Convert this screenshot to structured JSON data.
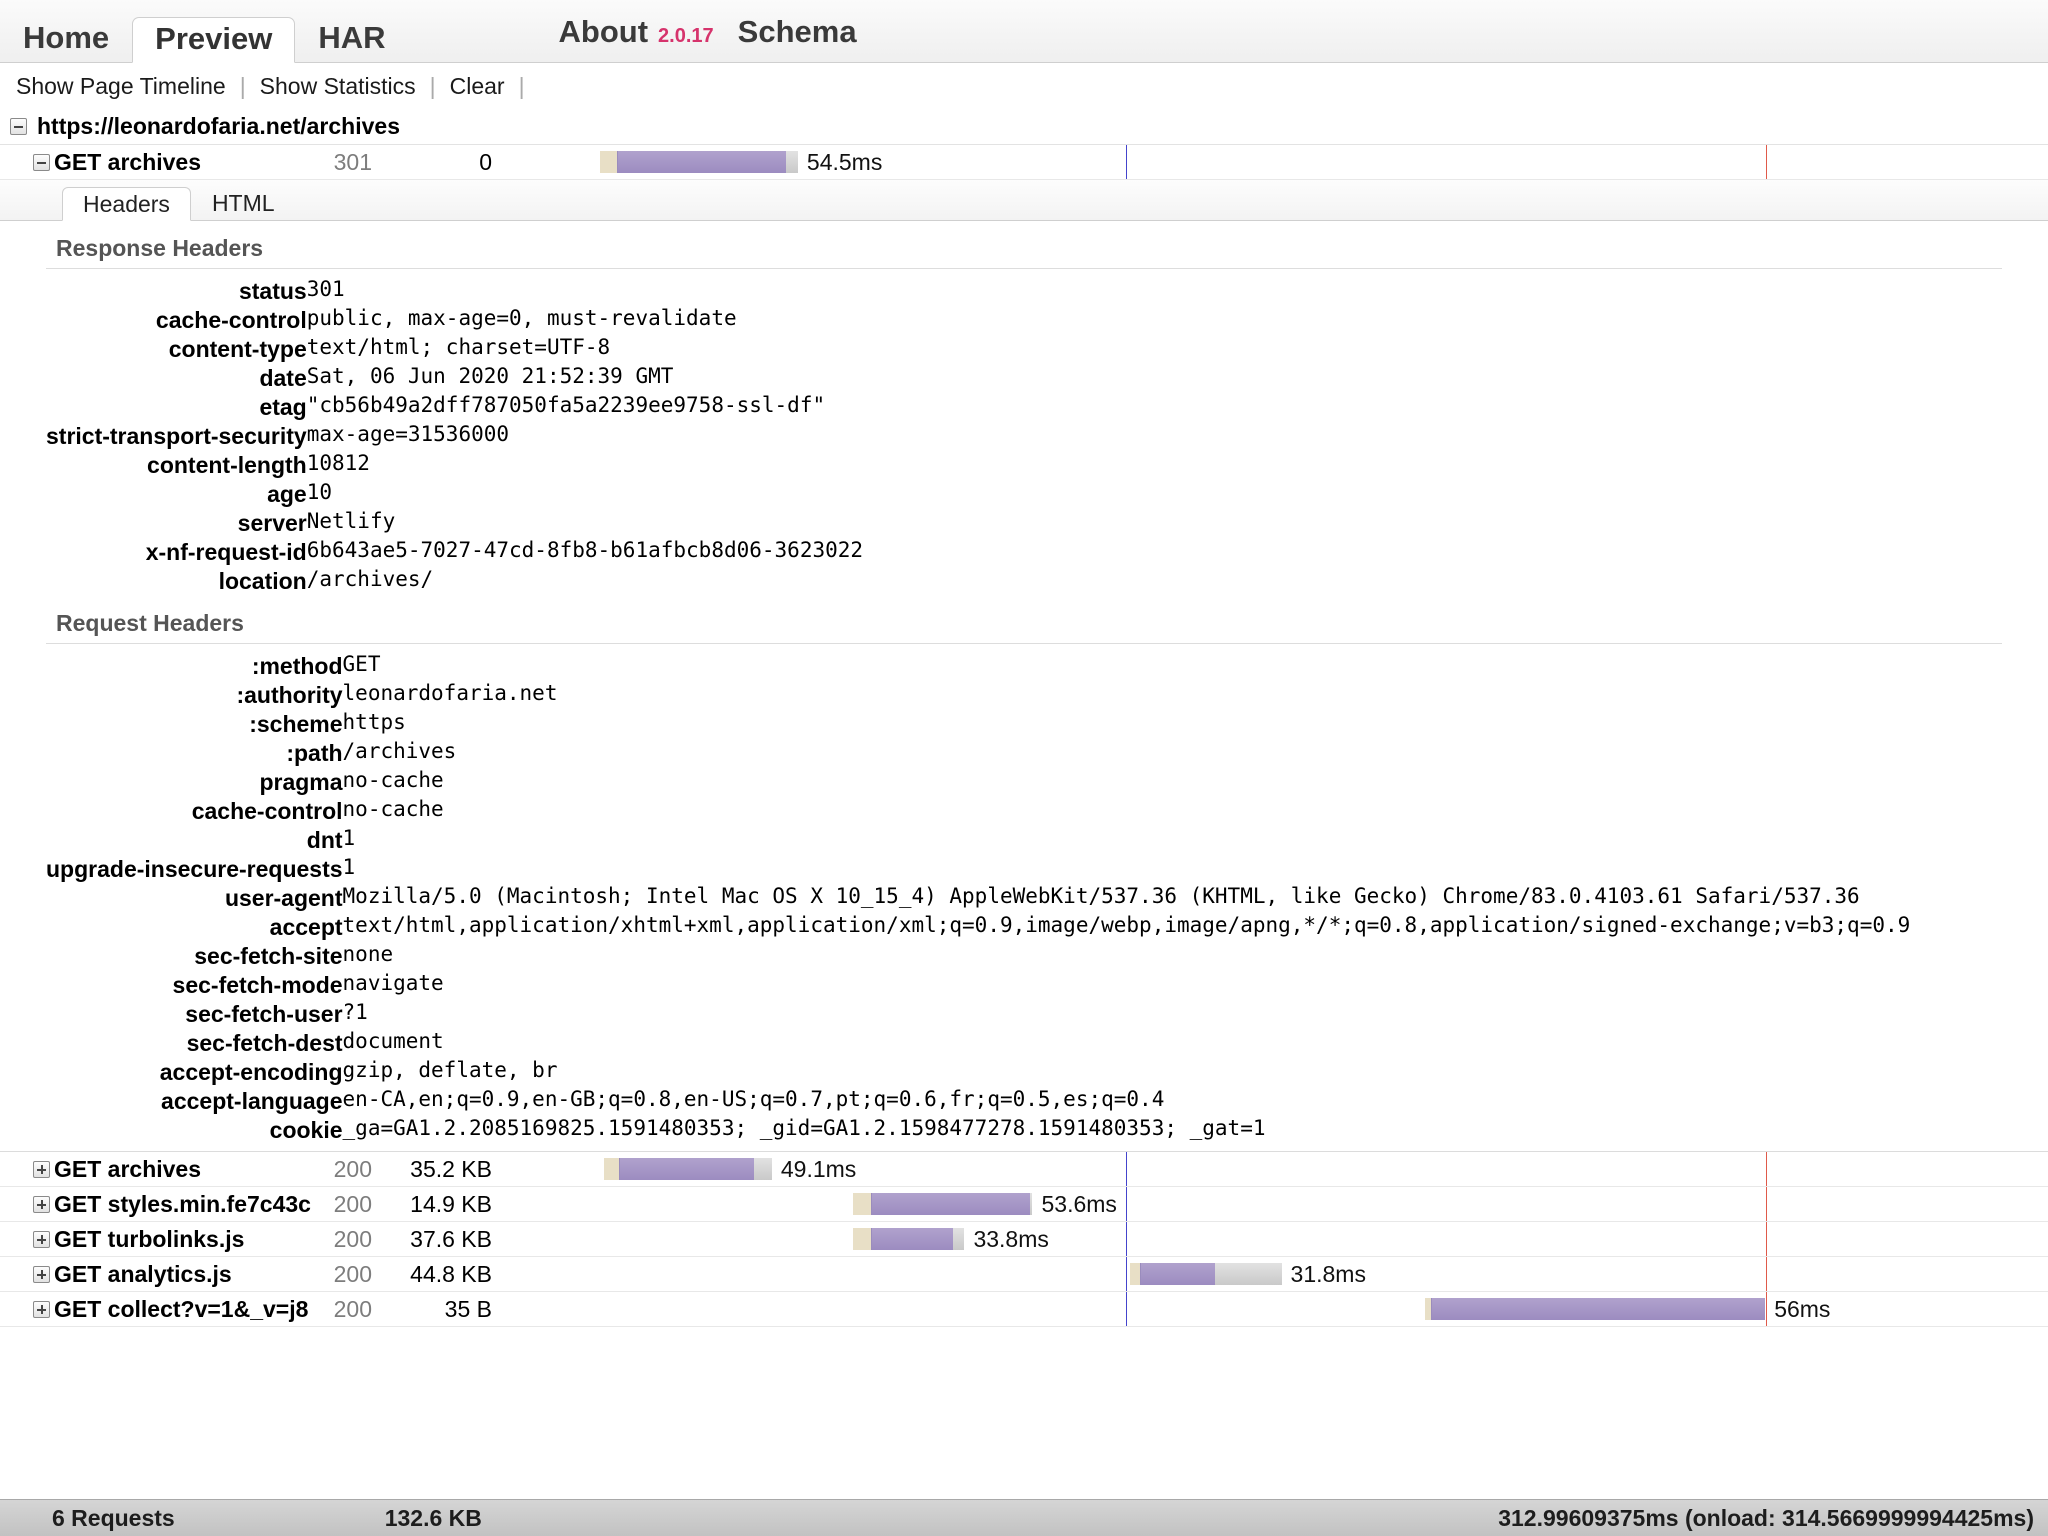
{
  "tabs": [
    {
      "label": "Home",
      "active": false
    },
    {
      "label": "Preview",
      "active": true
    },
    {
      "label": "HAR",
      "active": false
    }
  ],
  "about": {
    "label": "About",
    "version": "2.0.17",
    "schema": "Schema"
  },
  "toolbar": {
    "show_page_timeline": "Show Page Timeline",
    "show_statistics": "Show Statistics",
    "clear": "Clear",
    "separator": "|"
  },
  "page": {
    "url": "https://leonardofaria.net/archives"
  },
  "main_request": {
    "name": "GET archives",
    "status": "301",
    "size": "0",
    "time_label": "54.5ms",
    "bar": {
      "wait_pct": 1.2,
      "active_pct": 11.6,
      "tail_pct": 0.8,
      "offset_pct": 0
    }
  },
  "subtabs": [
    {
      "label": "Headers",
      "active": true
    },
    {
      "label": "HTML",
      "active": false
    }
  ],
  "response_headers": {
    "title": "Response Headers",
    "rows": [
      {
        "key": "status",
        "value": "301"
      },
      {
        "key": "cache-control",
        "value": "public, max-age=0, must-revalidate"
      },
      {
        "key": "content-type",
        "value": "text/html; charset=UTF-8"
      },
      {
        "key": "date",
        "value": "Sat, 06 Jun 2020 21:52:39 GMT"
      },
      {
        "key": "etag",
        "value": "\"cb56b49a2dff787050fa5a2239ee9758-ssl-df\""
      },
      {
        "key": "strict-transport-security",
        "value": "max-age=31536000"
      },
      {
        "key": "content-length",
        "value": "10812"
      },
      {
        "key": "age",
        "value": "10"
      },
      {
        "key": "server",
        "value": "Netlify"
      },
      {
        "key": "x-nf-request-id",
        "value": "6b643ae5-7027-47cd-8fb8-b61afbcb8d06-3623022"
      },
      {
        "key": "location",
        "value": "/archives/"
      }
    ]
  },
  "request_headers": {
    "title": "Request Headers",
    "rows": [
      {
        "key": ":method",
        "value": "GET"
      },
      {
        "key": ":authority",
        "value": "leonardofaria.net"
      },
      {
        "key": ":scheme",
        "value": "https"
      },
      {
        "key": ":path",
        "value": "/archives"
      },
      {
        "key": "pragma",
        "value": "no-cache"
      },
      {
        "key": "cache-control",
        "value": "no-cache"
      },
      {
        "key": "dnt",
        "value": "1"
      },
      {
        "key": "upgrade-insecure-requests",
        "value": "1"
      },
      {
        "key": "user-agent",
        "value": "Mozilla/5.0 (Macintosh; Intel Mac OS X 10_15_4) AppleWebKit/537.36 (KHTML, like Gecko) Chrome/83.0.4103.61 Safari/537.36"
      },
      {
        "key": "accept",
        "value": "text/html,application/xhtml+xml,application/xml;q=0.9,image/webp,image/apng,*/*;q=0.8,application/signed-exchange;v=b3;q=0.9"
      },
      {
        "key": "sec-fetch-site",
        "value": "none"
      },
      {
        "key": "sec-fetch-mode",
        "value": "navigate"
      },
      {
        "key": "sec-fetch-user",
        "value": "?1"
      },
      {
        "key": "sec-fetch-dest",
        "value": "document"
      },
      {
        "key": "accept-encoding",
        "value": "gzip, deflate, br"
      },
      {
        "key": "accept-language",
        "value": "en-CA,en;q=0.9,en-GB;q=0.8,en-US;q=0.7,pt;q=0.6,fr;q=0.5,es;q=0.4"
      },
      {
        "key": "cookie",
        "value": "_ga=GA1.2.2085169825.1591480353; _gid=GA1.2.1598477278.1591480353; _gat=1"
      }
    ]
  },
  "sub_requests": [
    {
      "name": "GET archives",
      "status": "200",
      "size": "35.2 KB",
      "time_label": "49.1ms",
      "bar": {
        "offset_pct": 0.3,
        "wait_pct": 1.0,
        "active_pct": 9.3,
        "tail_pct": 1.2
      }
    },
    {
      "name": "GET styles.min.fe7c43c",
      "status": "200",
      "size": "14.9 KB",
      "time_label": "53.6ms",
      "bar": {
        "offset_pct": 17.5,
        "wait_pct": 1.2,
        "active_pct": 10.9,
        "tail_pct": 0.2
      }
    },
    {
      "name": "GET turbolinks.js",
      "status": "200",
      "size": "37.6 KB",
      "time_label": "33.8ms",
      "bar": {
        "offset_pct": 17.5,
        "wait_pct": 1.2,
        "active_pct": 5.6,
        "tail_pct": 0.8
      }
    },
    {
      "name": "GET analytics.js",
      "status": "200",
      "size": "44.8 KB",
      "time_label": "31.8ms",
      "bar": {
        "offset_pct": 36.6,
        "wait_pct": 0.7,
        "active_pct": 5.1,
        "tail_pct": 4.6
      }
    },
    {
      "name": "GET collect?v=1&_v=j8",
      "status": "200",
      "size": "35 B",
      "time_label": "56ms",
      "bar": {
        "offset_pct": 57.0,
        "wait_pct": 0.4,
        "active_pct": 23.0,
        "tail_pct": 0
      }
    }
  ],
  "markers": {
    "onload_blue_pct": 36.3,
    "end_red_pct": 80.5
  },
  "footer": {
    "requests": "6 Requests",
    "total_size": "132.6 KB",
    "total_time": "312.99609375ms (onload: 314.5669999994425ms)"
  },
  "colors": {
    "accent_bar": "#9c8cc0",
    "wait_bar": "#e8dfc6",
    "tail_bar": "#c9c9c9",
    "version": "#d6336c",
    "onload_marker": "#4444cc",
    "end_marker": "#e05a4a"
  }
}
